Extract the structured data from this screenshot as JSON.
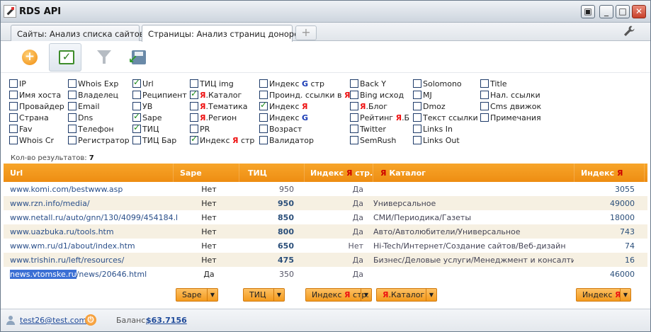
{
  "app": {
    "title": "RDS API"
  },
  "window_controls": {
    "restore": "▣",
    "minimize": "_",
    "maximize": "□",
    "close": "✕"
  },
  "tabs": [
    {
      "label": "Сайты: Анализ списка сайтов",
      "close": "×"
    },
    {
      "label": "Страницы: Анализ страниц доноров",
      "close": "×"
    }
  ],
  "tab_add": "+",
  "settings_icon": "wrench-icon",
  "toolbar": {
    "icons": [
      "add-icon",
      "checklist-icon",
      "filter-icon",
      "export-icon"
    ],
    "active_index": 1
  },
  "checkboxes": {
    "col1": [
      {
        "pre": "IP",
        "checked": false
      },
      {
        "pre": "Имя хоста",
        "checked": false
      },
      {
        "pre": "Провайдер",
        "checked": false
      },
      {
        "pre": "Страна",
        "checked": false
      },
      {
        "pre": "Fav",
        "checked": false
      },
      {
        "pre": "Whois Cr",
        "checked": false
      }
    ],
    "col2": [
      {
        "pre": "Whois Exp",
        "checked": false
      },
      {
        "pre": "Владелец",
        "checked": false
      },
      {
        "pre": "Email",
        "checked": false
      },
      {
        "pre": "Dns",
        "checked": false
      },
      {
        "pre": "Телефон",
        "checked": false
      },
      {
        "pre": "Регистратор",
        "checked": false
      }
    ],
    "col3": [
      {
        "pre": "Url",
        "checked": true
      },
      {
        "pre": "Реципиент",
        "checked": false
      },
      {
        "pre": "УВ",
        "checked": false
      },
      {
        "pre": "Sape",
        "checked": true
      },
      {
        "pre": "ТИЦ",
        "checked": true
      },
      {
        "pre": "ТИЦ Бар",
        "checked": false
      }
    ],
    "col4": [
      {
        "pre": "ТИЦ img",
        "checked": false
      },
      {
        "pre": "",
        "mark": "Я",
        "post": ".Каталог",
        "checked": true
      },
      {
        "pre": "",
        "mark": "Я",
        "post": ".Тематика",
        "checked": false
      },
      {
        "pre": "",
        "mark": "Я",
        "post": ".Регион",
        "checked": false
      },
      {
        "pre": "PR",
        "checked": false
      },
      {
        "pre": "Индекс ",
        "mark": "Я",
        "post": " стр",
        "checked": true
      }
    ],
    "col5": [
      {
        "pre": "Индекс ",
        "gmark": "G",
        "post": " стр",
        "checked": false
      },
      {
        "pre": "Проинд. ссылки в ",
        "mark": "Я",
        "checked": false
      },
      {
        "pre": "Индекс ",
        "mark": "Я",
        "checked": true
      },
      {
        "pre": "Индекс ",
        "gmark": "G",
        "checked": false
      },
      {
        "pre": "Возраст",
        "checked": false
      },
      {
        "pre": "Валидатор",
        "checked": false
      }
    ],
    "col6": [
      {
        "pre": "Back Y",
        "checked": false
      },
      {
        "pre": "Bing исход",
        "checked": false
      },
      {
        "pre": "",
        "mark": "Я",
        "post": ".Блог",
        "checked": false
      },
      {
        "pre": "Рейтинг ",
        "mark": "Я",
        "post": ".Б",
        "checked": false
      },
      {
        "pre": "Twitter",
        "checked": false
      },
      {
        "pre": "SemRush",
        "checked": false
      }
    ],
    "col7": [
      {
        "pre": "Solomono",
        "checked": false
      },
      {
        "pre": "MJ",
        "checked": false
      },
      {
        "pre": "Dmoz",
        "checked": false
      },
      {
        "pre": "Текст ссылки",
        "checked": false
      },
      {
        "pre": "Links In",
        "checked": false
      },
      {
        "pre": "Links Out",
        "checked": false
      }
    ],
    "col8": [
      {
        "pre": "Title",
        "checked": false
      },
      {
        "pre": "Нал. ссылки",
        "checked": false
      },
      {
        "pre": "Cms движок",
        "checked": false
      },
      {
        "pre": "Примечания",
        "checked": false
      }
    ]
  },
  "results": {
    "label": "Кол-во результатов:",
    "count": "7"
  },
  "table": {
    "headers": {
      "url": "Url",
      "sape": "Sape",
      "tic": "ТИЦ",
      "yidx_pre": "Индекс ",
      "yidx_mark": "Я",
      "yidx_post": " стр.",
      "cat_mark": "Я",
      "cat_post": " Каталог",
      "idx_pre": "Индекс ",
      "idx_mark": "Я"
    },
    "rows": [
      {
        "url": "www.komi.com/bestwww.asp",
        "sape": "Нет",
        "tic": "950",
        "tic_bold": false,
        "yidx": "Да",
        "cat": "",
        "idx": "3055"
      },
      {
        "url": "www.rzn.info/media/",
        "sape": "Нет",
        "tic": "950",
        "tic_bold": true,
        "yidx": "Да",
        "cat": "Универсальное",
        "idx": "49000"
      },
      {
        "url": "www.netall.ru/auto/gnn/130/4099/454184.html",
        "sape": "Нет",
        "tic": "850",
        "tic_bold": true,
        "yidx": "Да",
        "cat": "СМИ/Периодика/Газеты",
        "idx": "18000"
      },
      {
        "url": "www.uazbuka.ru/tools.htm",
        "sape": "Нет",
        "tic": "800",
        "tic_bold": true,
        "yidx": "Да",
        "cat": "Авто/Автолюбители/Универсальное",
        "idx": "743"
      },
      {
        "url": "www.wm.ru/d1/about/index.htm",
        "sape": "Нет",
        "tic": "650",
        "tic_bold": true,
        "yidx": "Нет",
        "cat": "Hi-Tech/Интернет/Создание сайтов/Веб-дизайн",
        "idx": "74"
      },
      {
        "url": "www.trishin.ru/left/resources/",
        "sape": "Нет",
        "tic": "475",
        "tic_bold": true,
        "yidx": "Да",
        "cat": "Бизнес/Деловые услуги/Менеджмент и консалтинг/Уни",
        "idx": "16"
      },
      {
        "url_hl": "news.vtomske.ru",
        "url_rest": "/news/20646.html",
        "sape": "Да",
        "tic": "350",
        "tic_bold": false,
        "yidx": "Да",
        "cat": "",
        "idx": "46000"
      }
    ]
  },
  "filter_buttons": {
    "sape": "Sape",
    "tic": "ТИЦ",
    "yidx_pre": "Индекс ",
    "yidx_mark": "Я",
    "yidx_post": " стр.",
    "cat_mark": "Я",
    "cat_post": ".Каталог",
    "idx_pre": "Индекс ",
    "idx_mark": "Я",
    "arrow": "▼"
  },
  "status": {
    "user": "test26@test.com",
    "balance_label": "Баланс:",
    "balance": "$63.7156"
  }
}
